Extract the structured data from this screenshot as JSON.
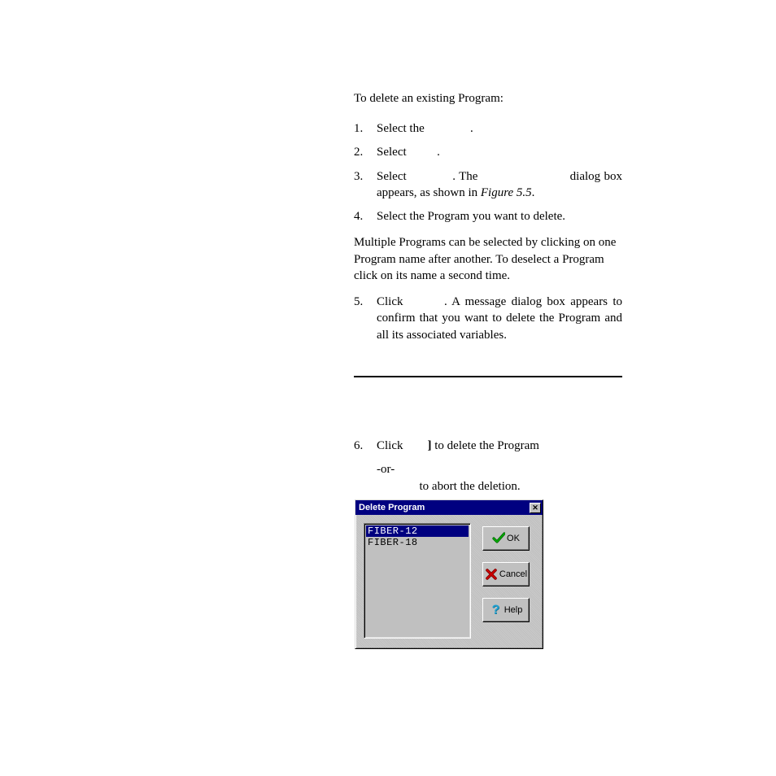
{
  "intro": "To delete an existing Program:",
  "steps": {
    "s1_num": "1.",
    "s1a": "Select the ",
    "s1b": ".",
    "s2_num": "2.",
    "s2a": "Select ",
    "s2b": ".",
    "s3_num": "3.",
    "s3a": "Select ",
    "s3b": ". The ",
    "s3c": " dialog box appears, as shown in ",
    "s3_fig": "Figure 5.5",
    "s3d": ".",
    "s4_num": "4.",
    "s4": "Select the Program you want to delete.",
    "s5_num": "5.",
    "s5a": "Click ",
    "s5b": ". A message dialog box appears to confirm that you want to delete the Program and all its associated variables.",
    "s6_num": "6.",
    "s6a": "Click ",
    "s6_bracket": "]",
    "s6b": " to delete the Program",
    "s6_or": "-or-",
    "s6c": "to abort the deletion."
  },
  "note": "Multiple Programs can be selected by clicking on one Program name after another. To deselect a Program click on its name a second time.",
  "dialog": {
    "title": "Delete Program",
    "close_glyph": "✕",
    "items": [
      "FIBER-12",
      "FIBER-18"
    ],
    "ok_label": "OK",
    "cancel_label": "Cancel",
    "help_label": "Help"
  }
}
